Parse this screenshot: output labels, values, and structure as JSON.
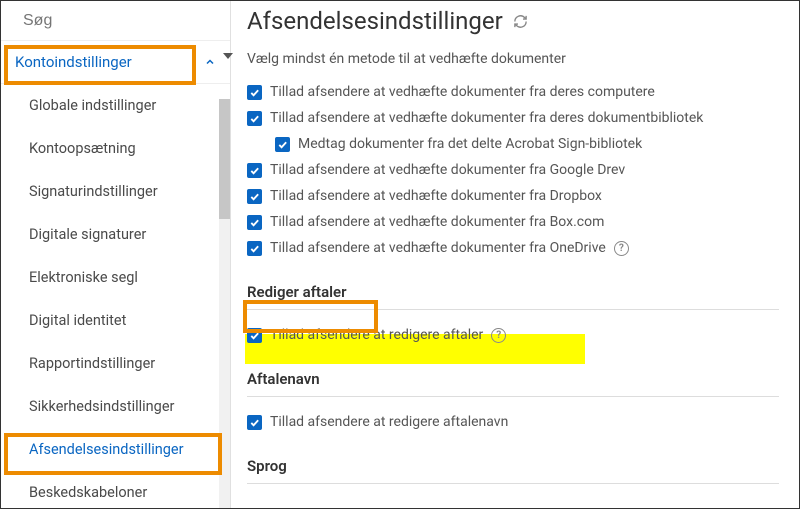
{
  "search": {
    "placeholder": "Søg"
  },
  "sidebar": {
    "section_label": "Kontoindstillinger",
    "items": [
      {
        "label": "Globale indstillinger"
      },
      {
        "label": "Kontoopsætning"
      },
      {
        "label": "Signaturindstillinger"
      },
      {
        "label": "Digitale signaturer"
      },
      {
        "label": "Elektroniske segl"
      },
      {
        "label": "Digital identitet"
      },
      {
        "label": "Rapportindstillinger"
      },
      {
        "label": "Sikkerhedsindstillinger"
      },
      {
        "label": "Afsendelsesindstillinger"
      },
      {
        "label": "Beskedskabeloner"
      }
    ]
  },
  "main": {
    "title": "Afsendelsesindstillinger",
    "intro": "Vælg mindst én metode til at vedhæfte dokumenter",
    "attach": {
      "opt_computer": "Tillad afsendere at vedhæfte dokumenter fra deres computere",
      "opt_library": "Tillad afsendere at vedhæfte dokumenter fra deres dokumentbibliotek",
      "opt_library_shared": "Medtag dokumenter fra det delte Acrobat Sign-bibliotek",
      "opt_google": "Tillad afsendere at vedhæfte dokumenter fra Google Drev",
      "opt_dropbox": "Tillad afsendere at vedhæfte dokumenter fra Dropbox",
      "opt_box": "Tillad afsendere at vedhæfte dokumenter fra Box.com",
      "opt_onedrive": "Tillad afsendere at vedhæfte dokumenter fra OneDrive"
    },
    "section_edit": {
      "title": "Rediger aftaler",
      "opt_edit": "Tillad afsendere at redigere aftaler"
    },
    "section_name": {
      "title": "Aftalenavn",
      "opt_name": "Tillad afsendere at redigere aftalenavn"
    },
    "section_lang": {
      "title": "Sprog"
    }
  },
  "info_glyph": "?"
}
